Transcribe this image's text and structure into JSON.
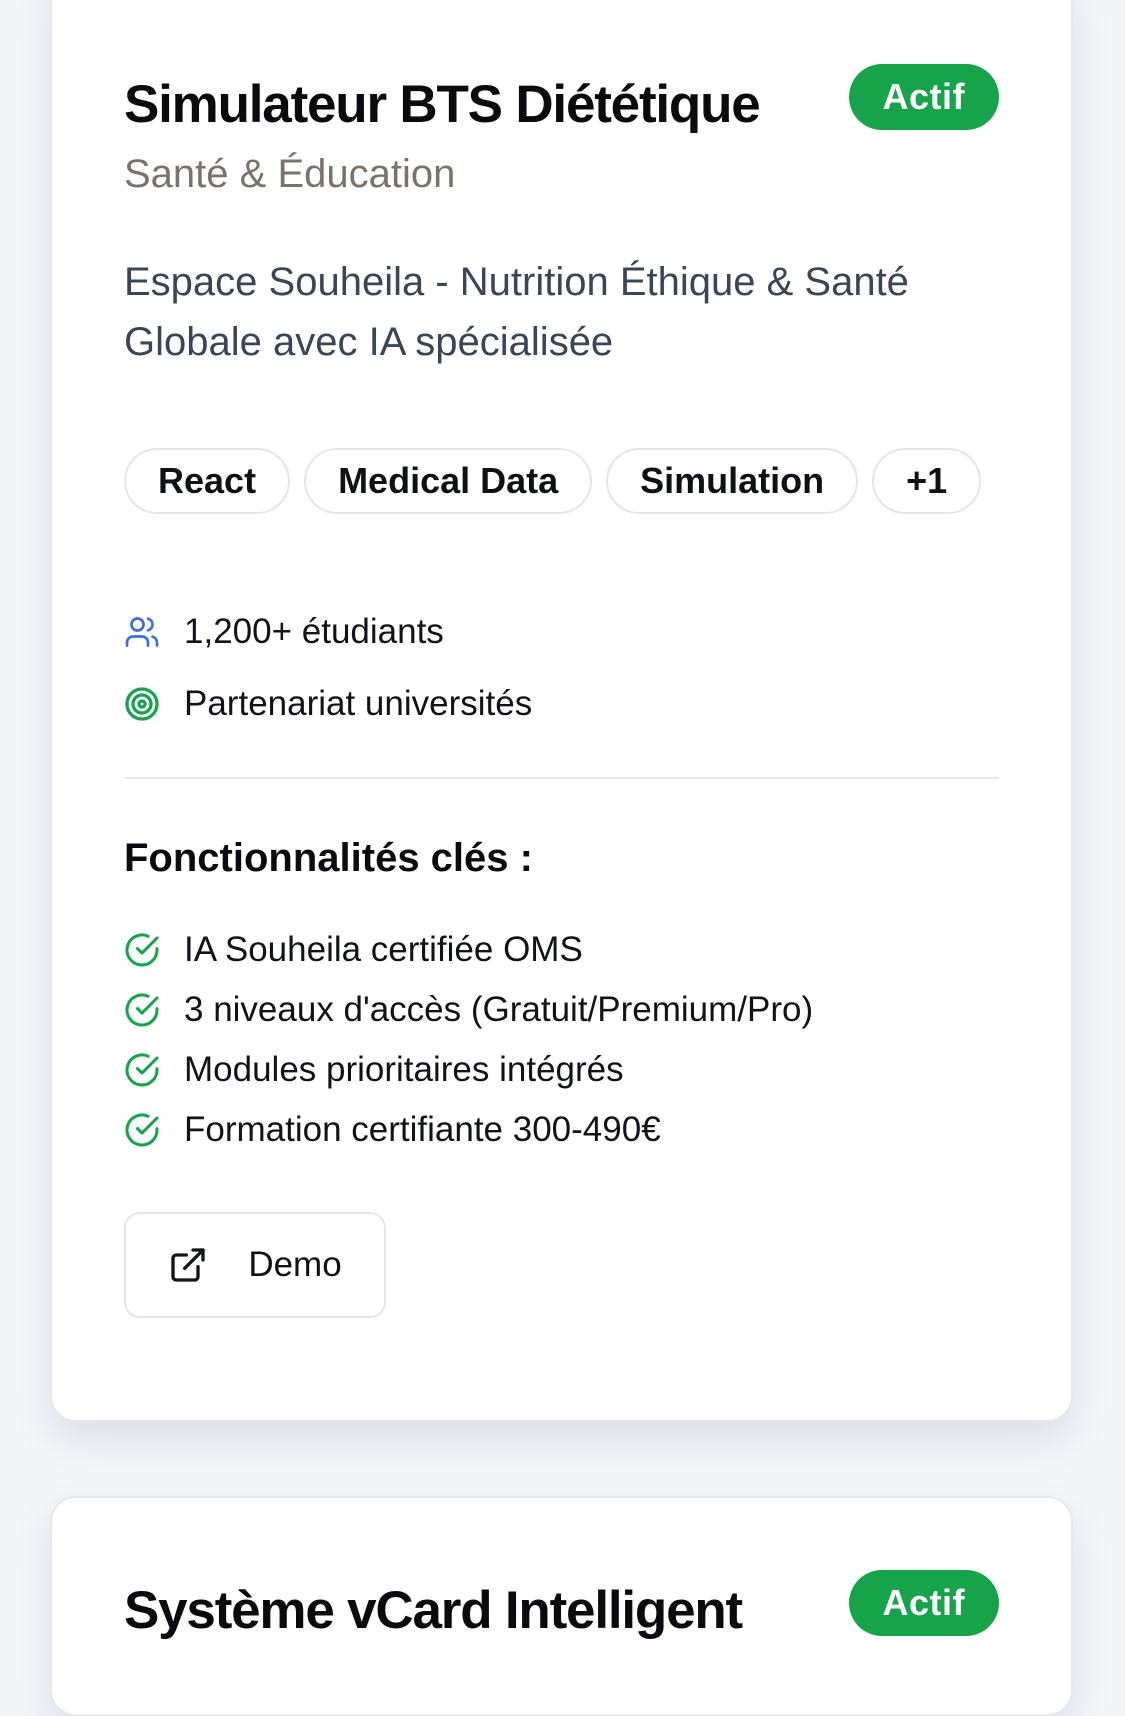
{
  "projects": [
    {
      "title": "Simulateur BTS Diététique",
      "status": "Actif",
      "category": "Santé & Éducation",
      "description": "Espace Souheila - Nutrition Éthique & Santé Globale avec IA spécialisée",
      "tags": [
        "React",
        "Medical Data",
        "Simulation",
        "+1"
      ],
      "meta": {
        "users_icon": "users-icon",
        "users": "1,200+ étudiants",
        "partner_icon": "target-icon",
        "partner": "Partenariat universités"
      },
      "features_heading": "Fonctionnalités clés :",
      "features": [
        "IA Souheila certifiée OMS",
        "3 niveaux d'accès (Gratuit/Premium/Pro)",
        "Modules prioritaires intégrés",
        "Formation certifiante 300-490€"
      ],
      "demo_icon": "external-link-icon",
      "demo_label": "Demo"
    },
    {
      "title": "Système vCard Intelligent",
      "status": "Actif"
    }
  ],
  "colors": {
    "status_active": "#16a34a",
    "users_icon": "#3b6fe0",
    "target_icon": "#16a34a",
    "check_icon": "#16a34a",
    "category_text": "#7a736d",
    "description_text": "#3b4557"
  }
}
